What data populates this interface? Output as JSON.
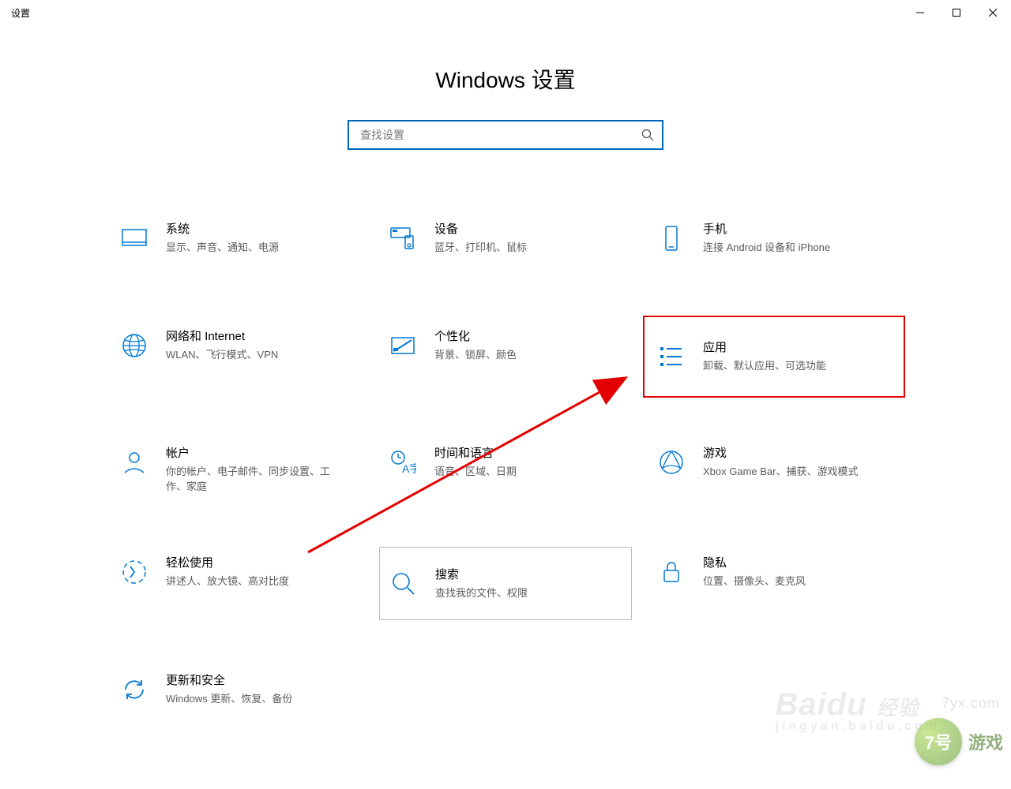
{
  "window": {
    "title": "设置"
  },
  "page": {
    "heading": "Windows 设置",
    "search_placeholder": "查找设置"
  },
  "tiles": [
    {
      "key": "system",
      "title": "系统",
      "desc": "显示、声音、通知、电源"
    },
    {
      "key": "devices",
      "title": "设备",
      "desc": "蓝牙、打印机、鼠标"
    },
    {
      "key": "phone",
      "title": "手机",
      "desc": "连接 Android 设备和 iPhone"
    },
    {
      "key": "network",
      "title": "网络和 Internet",
      "desc": "WLAN、飞行模式、VPN"
    },
    {
      "key": "personal",
      "title": "个性化",
      "desc": "背景、锁屏、颜色"
    },
    {
      "key": "apps",
      "title": "应用",
      "desc": "卸载、默认应用、可选功能"
    },
    {
      "key": "accounts",
      "title": "帐户",
      "desc": "你的帐户、电子邮件、同步设置、工作、家庭"
    },
    {
      "key": "time",
      "title": "时间和语言",
      "desc": "语音、区域、日期"
    },
    {
      "key": "gaming",
      "title": "游戏",
      "desc": "Xbox Game Bar、捕获、游戏模式"
    },
    {
      "key": "ease",
      "title": "轻松使用",
      "desc": "讲述人、放大镜、高对比度"
    },
    {
      "key": "search",
      "title": "搜索",
      "desc": "查找我的文件、权限"
    },
    {
      "key": "privacy",
      "title": "隐私",
      "desc": "位置、摄像头、麦克风"
    },
    {
      "key": "update",
      "title": "更新和安全",
      "desc": "Windows 更新、恢复、备份"
    }
  ],
  "annotation": {
    "highlight_key": "apps",
    "hover_key": "search",
    "arrow_color": "#e40000"
  },
  "watermarks": {
    "baidu_main": "Baidu",
    "baidu_sub": "经验",
    "baidu_url": "jingyan.baidu.com",
    "site_url": "7yx.com",
    "site_badge": "7号",
    "site_text": "游戏"
  },
  "colors": {
    "accent": "#0078d4",
    "search_border": "#0067c0"
  }
}
